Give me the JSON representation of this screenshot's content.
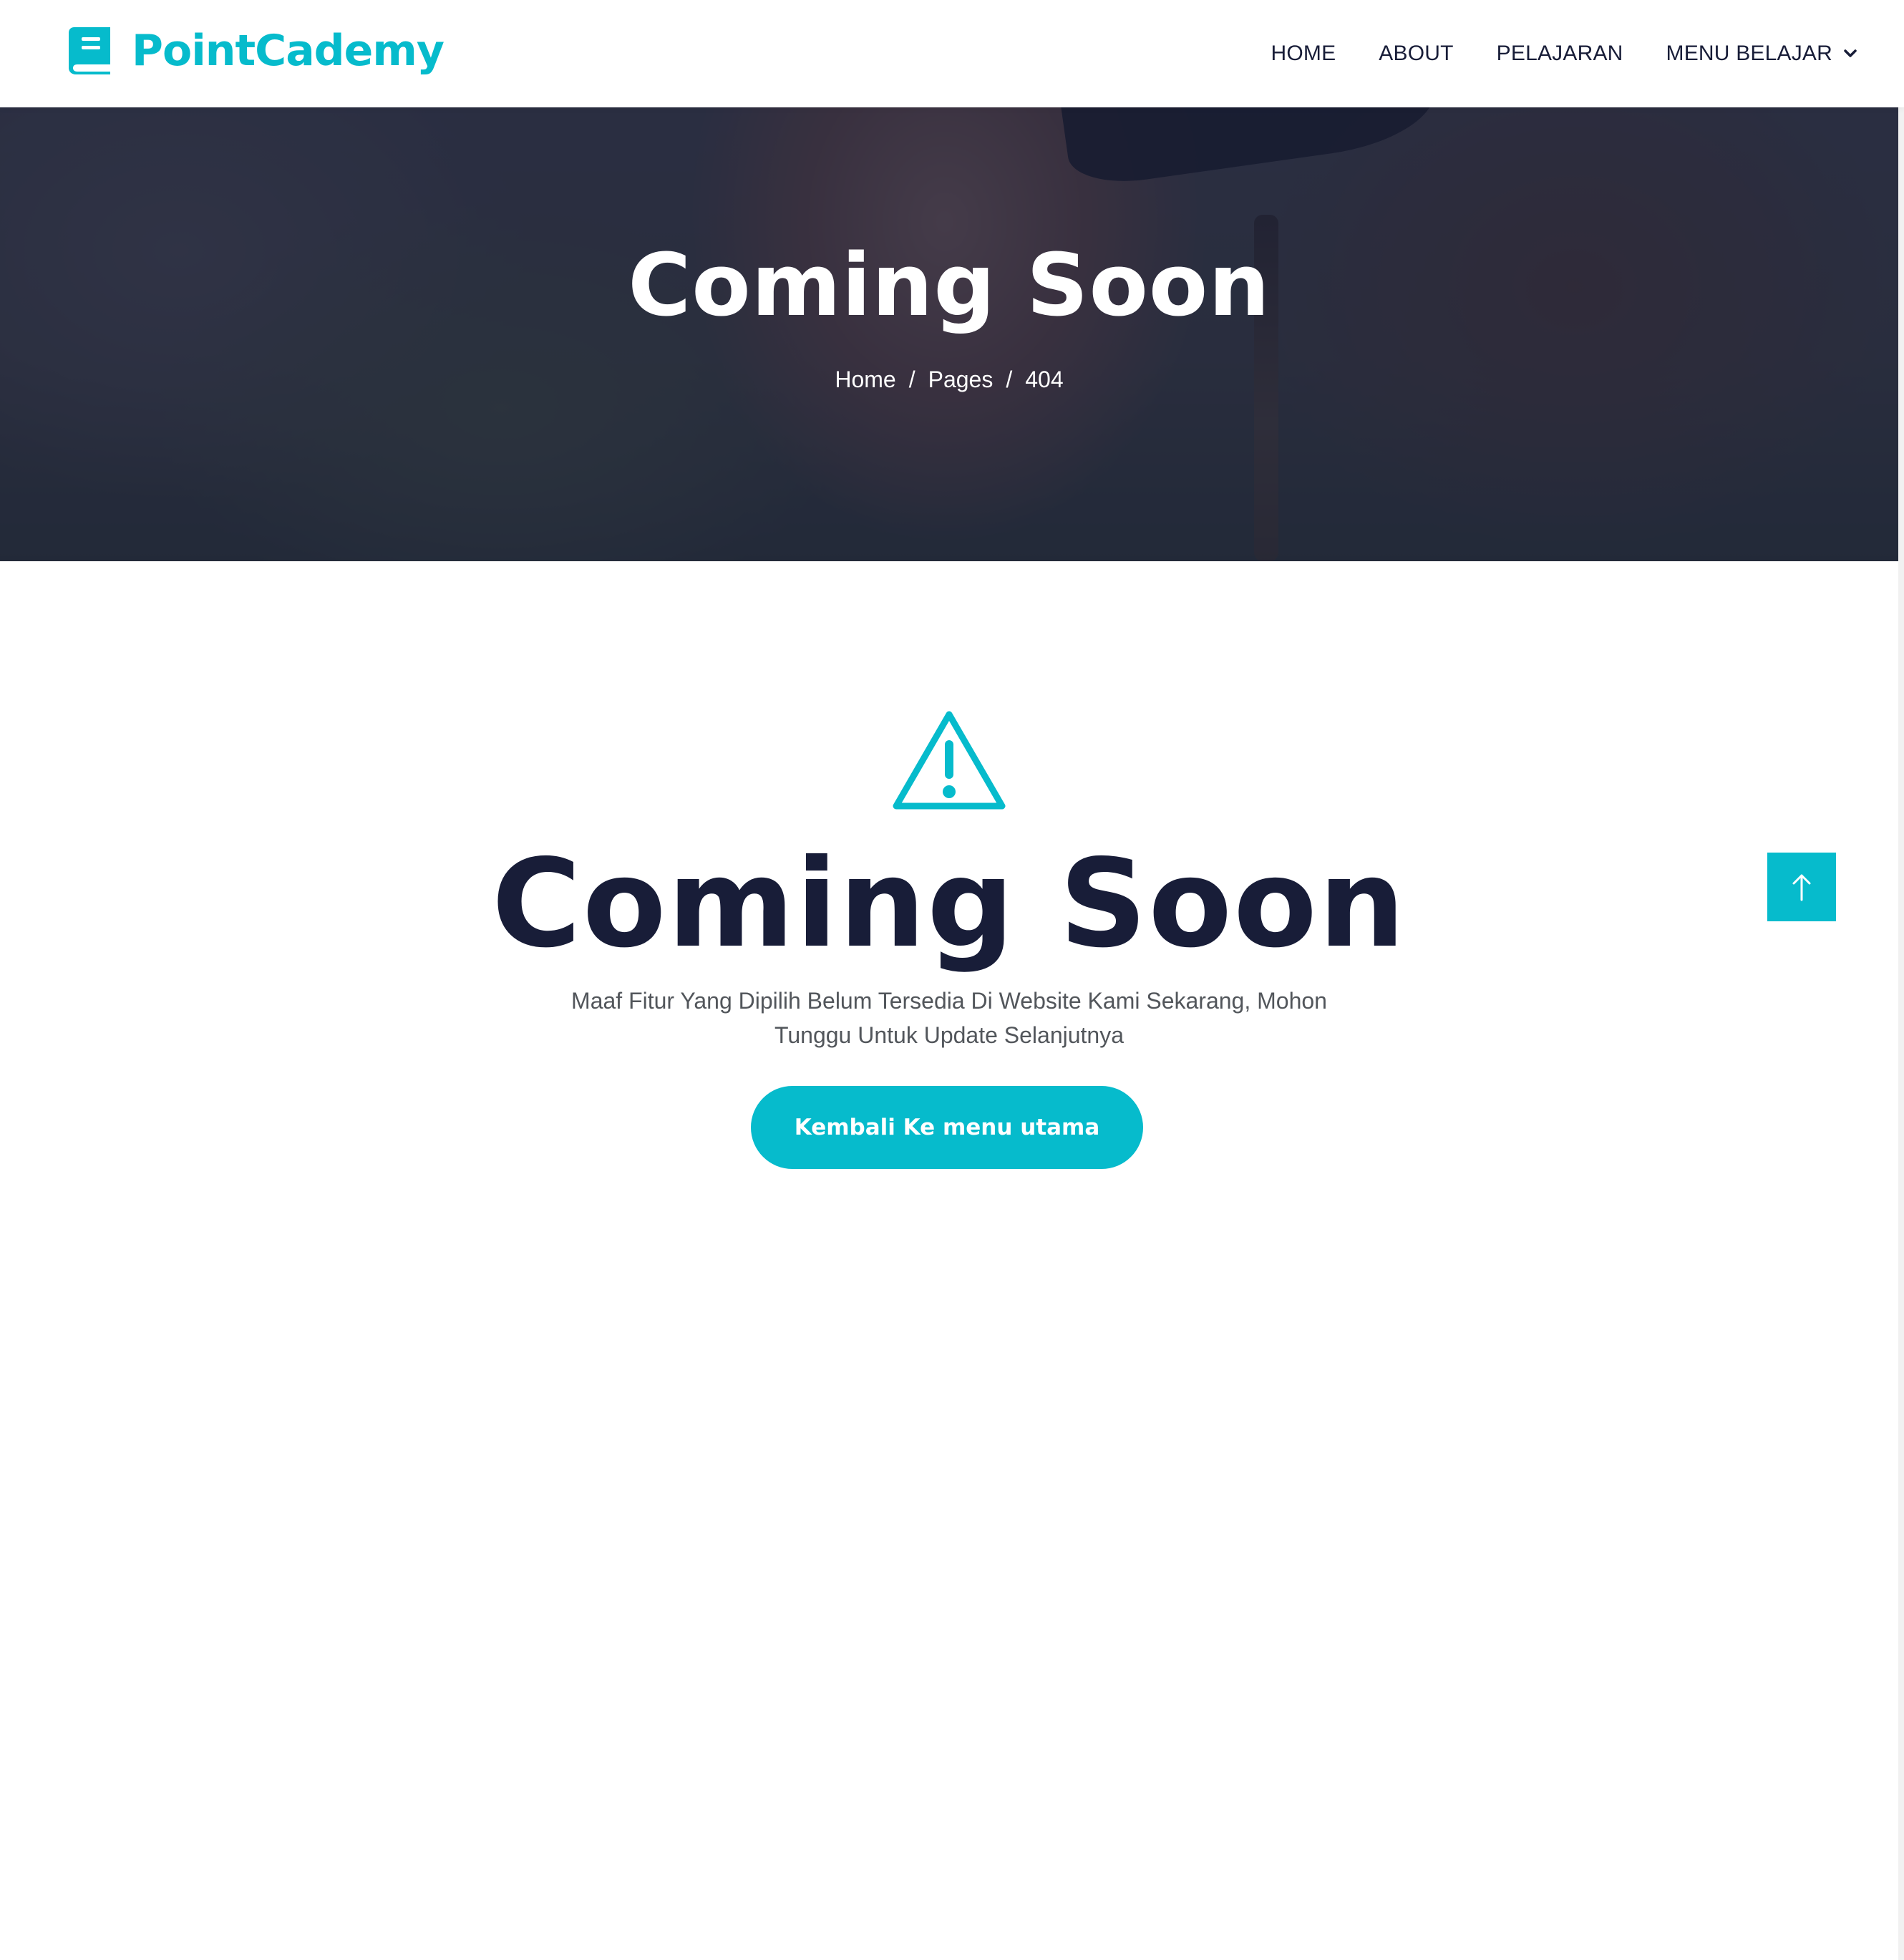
{
  "colors": {
    "accent": "#06bbcc",
    "heading": "#181d38",
    "body_text": "#52565b"
  },
  "brand": {
    "name": "PointCademy",
    "icon": "book-icon"
  },
  "nav": {
    "items": [
      {
        "label": "HOME"
      },
      {
        "label": "ABOUT"
      },
      {
        "label": "PELAJARAN"
      },
      {
        "label": "MENU BELAJAR",
        "icon": "chevron-down-icon"
      }
    ]
  },
  "hero": {
    "title": "Coming Soon",
    "breadcrumb": {
      "items": [
        "Home",
        "Pages",
        "404"
      ],
      "separator": "/"
    }
  },
  "content": {
    "icon": "warning-triangle-icon",
    "title": "Coming Soon",
    "message": "Maaf Fitur Yang Dipilih Belum Tersedia Di Website Kami Sekarang, Mohon Tunggu Untuk Update Selanjutnya",
    "button_label": "Kembali Ke menu utama"
  },
  "back_to_top": {
    "icon": "arrow-up-icon"
  }
}
